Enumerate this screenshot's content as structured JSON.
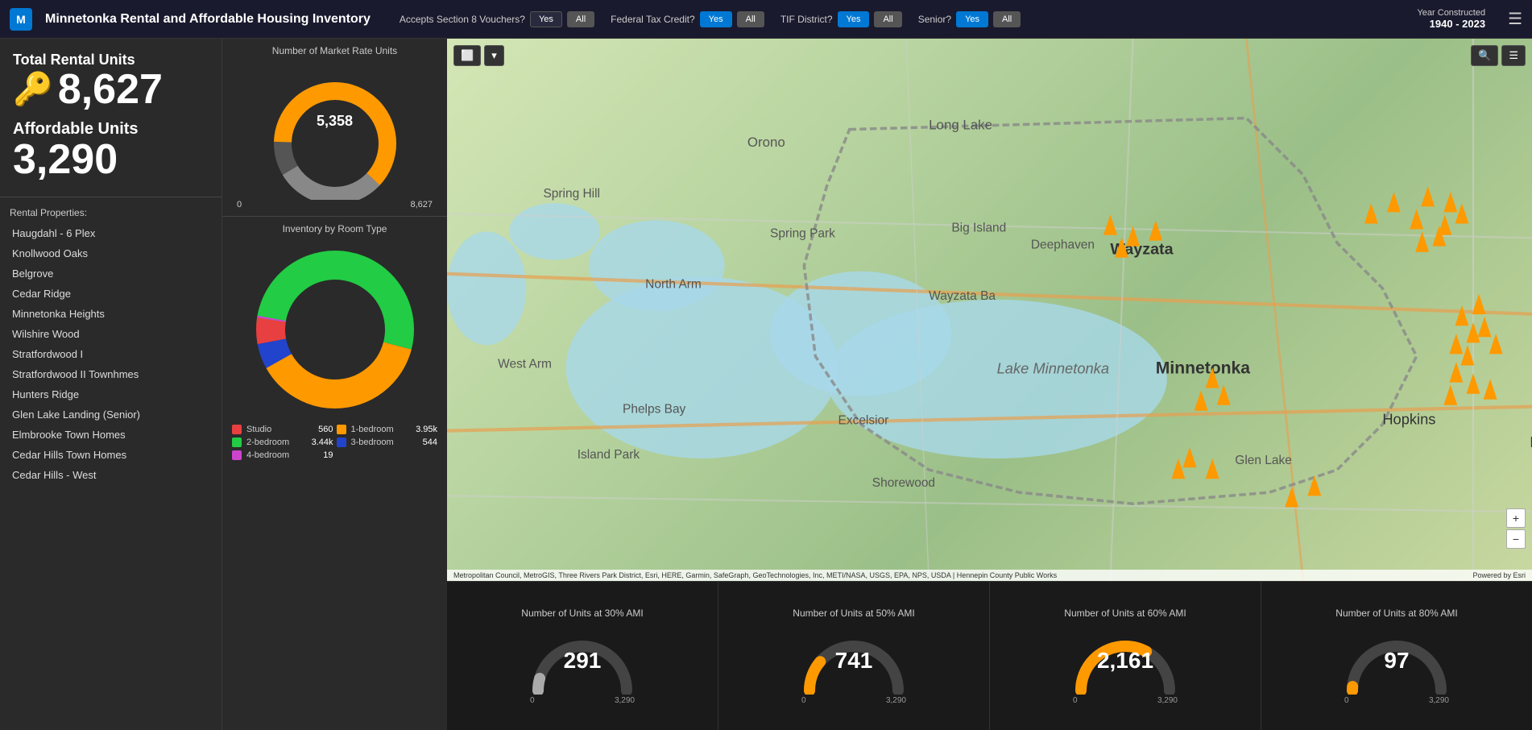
{
  "header": {
    "logo_text": "M",
    "title": "Minnetonka Rental and Affordable Housing Inventory",
    "filters": {
      "section8_label": "Accepts Section 8 Vouchers?",
      "section8_yes": "Yes",
      "section8_all": "All",
      "tax_credit_label": "Federal Tax Credit?",
      "tax_credit_yes": "Yes",
      "tax_credit_all": "All",
      "tif_label": "TIF District?",
      "tif_yes": "Yes",
      "tif_all": "All",
      "senior_label": "Senior?",
      "senior_yes": "Yes",
      "senior_all": "All"
    },
    "year_label": "Year Constructed",
    "year_range": "1940 - 2023",
    "menu_icon": "☰"
  },
  "stats": {
    "total_label": "Total Rental Units",
    "total_value": "8,627",
    "affordable_label": "Affordable Units",
    "affordable_value": "3,290"
  },
  "market_rate": {
    "chart_title": "Number of Market Rate Units",
    "value": "5,358",
    "min": "0",
    "max": "8,627",
    "pct_filled": 0.62
  },
  "room_type": {
    "chart_title": "Inventory by Room Type",
    "legend": [
      {
        "label": "Studio",
        "value": "560",
        "color": "#e84040"
      },
      {
        "label": "1-bedroom",
        "value": "3.95k",
        "color": "#f90"
      },
      {
        "label": "2-bedroom",
        "value": "3.44k",
        "color": "#22cc44"
      },
      {
        "label": "3-bedroom",
        "value": "544",
        "color": "#2244cc"
      },
      {
        "label": "4-bedroom",
        "value": "19",
        "color": "#cc44cc"
      }
    ]
  },
  "properties": {
    "title": "Rental Properties:",
    "items": [
      "Haugdahl - 6 Plex",
      "Knollwood Oaks",
      "Belgrove",
      "Cedar Ridge",
      "Minnetonka Heights",
      "Wilshire Wood",
      "Stratfordwood I",
      "Stratfordwood II Townhmes",
      "Hunters Ridge",
      "Glen Lake Landing (Senior)",
      "Elmbrooke Town Homes",
      "Cedar Hills Town Homes",
      "Cedar Hills - West"
    ]
  },
  "gauges": [
    {
      "title": "Number of Units at 30% AMI",
      "value": "291",
      "min": "0",
      "max": "3,290",
      "pct": 0.088,
      "color": "#aaa"
    },
    {
      "title": "Number of Units at 50% AMI",
      "value": "741",
      "min": "0",
      "max": "3,290",
      "pct": 0.225,
      "color": "#f90"
    },
    {
      "title": "Number of Units at 60% AMI",
      "value": "2,161",
      "min": "0",
      "max": "3,290",
      "pct": 0.657,
      "color": "#f90"
    },
    {
      "title": "Number of Units at 80% AMI",
      "value": "97",
      "min": "0",
      "max": "3,290",
      "pct": 0.029,
      "color": "#f90"
    }
  ],
  "map": {
    "attribution": "Metropolitan Council, MetroGIS, Three Rivers Park District, Esri, HERE, Garmin, SafeGraph, GeoTechnologies, Inc, METI/NASA, USGS, EPA, NPS, USDA | Hennepin County Public Works",
    "powered_by": "Powered by Esri"
  }
}
